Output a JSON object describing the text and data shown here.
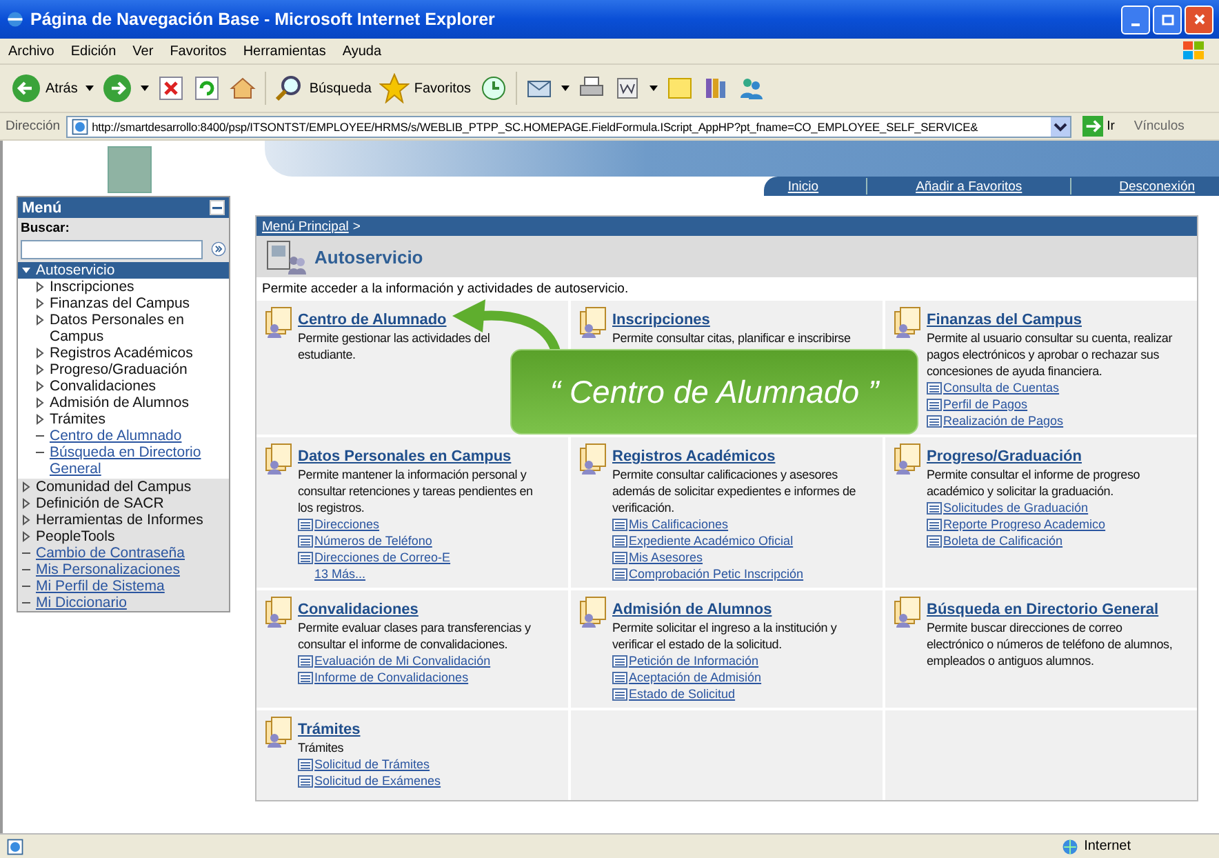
{
  "window": {
    "title": "Página de Navegación Base - Microsoft Internet Explorer"
  },
  "menu_bar": [
    "Archivo",
    "Edición",
    "Ver",
    "Favoritos",
    "Herramientas",
    "Ayuda"
  ],
  "toolbar": {
    "back": "Atrás",
    "search": "Búsqueda",
    "favorites": "Favoritos"
  },
  "address_bar": {
    "label": "Dirección",
    "value": "http://smartdesarrollo:8400/psp/ITSONTST/EMPLOYEE/HRMS/s/WEBLIB_PTPP_SC.HOMEPAGE.FieldFormula.IScript_AppHP?pt_fname=CO_EMPLOYEE_SELF_SERVICE&",
    "go": "Ir",
    "links": "Vínculos"
  },
  "header_nav": [
    "Inicio",
    "Añadir a Favoritos",
    "Desconexión"
  ],
  "sidebar": {
    "title": "Menú",
    "search_label": "Buscar:",
    "items": [
      {
        "label": "Autoservicio",
        "kind": "folder",
        "expanded": true,
        "children": [
          {
            "label": "Inscripciones",
            "kind": "folder",
            "expanded": false
          },
          {
            "label": "Finanzas del Campus",
            "kind": "folder",
            "expanded": false
          },
          {
            "label": "Datos Personales en Campus",
            "kind": "folder",
            "expanded": false
          },
          {
            "label": "Registros Académicos",
            "kind": "folder",
            "expanded": false
          },
          {
            "label": "Progreso/Graduación",
            "kind": "folder",
            "expanded": false
          },
          {
            "label": "Convalidaciones",
            "kind": "folder",
            "expanded": false
          },
          {
            "label": "Admisión de Alumnos",
            "kind": "folder",
            "expanded": false
          },
          {
            "label": "Trámites",
            "kind": "folder",
            "expanded": false
          },
          {
            "label": "Centro de Alumnado",
            "kind": "link"
          },
          {
            "label": "Búsqueda en Directorio General",
            "kind": "link"
          }
        ]
      },
      {
        "label": "Comunidad del Campus",
        "kind": "folder",
        "expanded": false
      },
      {
        "label": "Definición de SACR",
        "kind": "folder",
        "expanded": false
      },
      {
        "label": "Herramientas de Informes",
        "kind": "folder",
        "expanded": false
      },
      {
        "label": "PeopleTools",
        "kind": "folder",
        "expanded": false
      },
      {
        "label": "Cambio de Contraseña",
        "kind": "link"
      },
      {
        "label": "Mis Personalizaciones",
        "kind": "link"
      },
      {
        "label": "Mi Perfil de Sistema",
        "kind": "link"
      },
      {
        "label": "Mi Diccionario",
        "kind": "link"
      }
    ]
  },
  "content": {
    "breadcrumb": "Menú Principal",
    "breadcrumb_sep": ">",
    "title": "Autoservicio",
    "description": "Permite acceder a la información y actividades de autoservicio.",
    "tiles": [
      {
        "title": "Centro de Alumnado",
        "description": "Permite gestionar las actividades del estudiante."
      },
      {
        "title": "Inscripciones",
        "description": "Permite consultar citas, planificar e inscribirse"
      },
      {
        "title": "Finanzas del Campus",
        "description": "Permite al usuario consultar su cuenta, realizar pagos electrónicos y aprobar o rechazar sus concesiones de ayuda financiera.",
        "links": [
          "Consulta de Cuentas",
          "Perfil de Pagos",
          "Realización de Pagos"
        ]
      },
      {
        "title": "Datos Personales en Campus",
        "description": "Permite mantener la información personal y consultar retenciones y tareas pendientes en los registros.",
        "links": [
          "Direcciones",
          "Números de Teléfono",
          "Direcciones de Correo-E"
        ],
        "more": "13 Más..."
      },
      {
        "title": "Registros Académicos",
        "description": "Permite consultar calificaciones y asesores además de solicitar expedientes e informes de verificación.",
        "links": [
          "Mis Calificaciones",
          "Expediente Académico Oficial",
          "Mis Asesores",
          "Comprobación Petic Inscripción"
        ]
      },
      {
        "title": "Progreso/Graduación",
        "description": "Permite consultar el informe de progreso académico y solicitar la graduación.",
        "links": [
          "Solicitudes de Graduación",
          "Reporte Progreso Academico",
          "Boleta de Calificación"
        ]
      },
      {
        "title": "Convalidaciones",
        "description": "Permite evaluar clases para transferencias y consultar el informe de convalidaciones.",
        "links": [
          "Evaluación de Mi Convalidación",
          "Informe de Convalidaciones"
        ]
      },
      {
        "title": "Admisión de Alumnos",
        "description": "Permite solicitar el ingreso a la institución y verificar el estado de la solicitud.",
        "links": [
          "Petición de Información",
          "Aceptación de Admisión",
          "Estado de Solicitud"
        ]
      },
      {
        "title": "Búsqueda en Directorio General",
        "description": "Permite buscar direcciones de correo electrónico o números de teléfono de alumnos, empleados o antiguos alumnos."
      },
      {
        "title": "Trámites",
        "description": "Trámites",
        "links": [
          "Solicitud de Trámites",
          "Solicitud de Exámenes"
        ]
      }
    ]
  },
  "callout": {
    "text": "“ Centro de Alumnado ”"
  },
  "status_bar": {
    "zone": "Internet"
  }
}
